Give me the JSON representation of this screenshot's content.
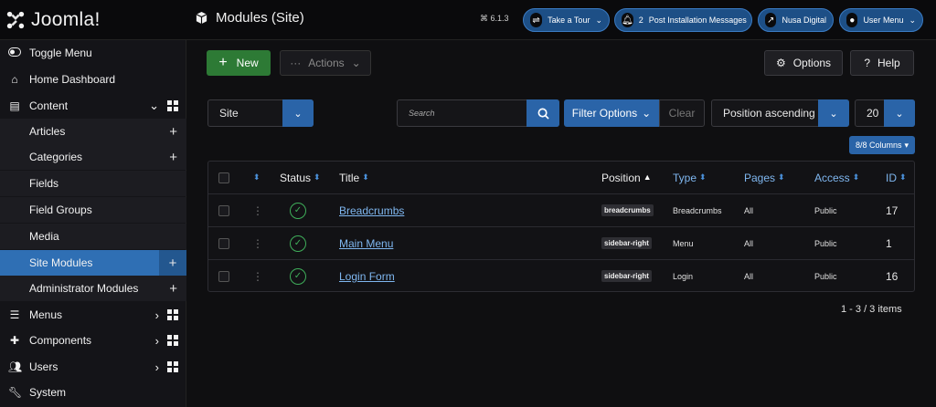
{
  "app": {
    "logo_text": "Joomla!",
    "page_title": "Modules (Site)",
    "version": "⌘ 6.1.3"
  },
  "header_buttons": [
    {
      "label": "Take a Tour",
      "icon": "signpost-icon"
    },
    {
      "label": "Post Installation Messages",
      "count": "2",
      "icon": "bell-icon"
    },
    {
      "label": "Nusa Digital",
      "icon": "external-link-icon"
    },
    {
      "label": "User Menu",
      "icon": "user-icon"
    }
  ],
  "sidebar": {
    "items": [
      {
        "label": "Toggle Menu",
        "icon": "toggle-icon"
      },
      {
        "label": "Home Dashboard",
        "icon": "home-icon"
      },
      {
        "label": "Content",
        "icon": "file-icon"
      },
      {
        "label": "Articles"
      },
      {
        "label": "Categories"
      },
      {
        "label": "Fields"
      },
      {
        "label": "Field Groups"
      },
      {
        "label": "Media"
      },
      {
        "label": "Site Modules"
      },
      {
        "label": "Administrator Modules"
      },
      {
        "label": "Menus",
        "icon": "list-icon"
      },
      {
        "label": "Components",
        "icon": "puzzle-icon"
      },
      {
        "label": "Users",
        "icon": "users-icon"
      },
      {
        "label": "System",
        "icon": "wrench-icon"
      }
    ]
  },
  "toolbar": {
    "new_label": "New",
    "actions_label": "Actions",
    "options_label": "Options",
    "help_label": "Help"
  },
  "filters": {
    "client_value": "Site",
    "search_placeholder": "Search",
    "filter_options_label": "Filter Options",
    "clear_label": "Clear",
    "ordering_value": "Position ascending",
    "limit_value": "20",
    "columns_label": "8/8 Columns"
  },
  "table": {
    "headers": {
      "status": "Status",
      "title": "Title",
      "position": "Position",
      "type": "Type",
      "pages": "Pages",
      "access": "Access",
      "id": "ID"
    },
    "rows": [
      {
        "title": "Breadcrumbs",
        "position": "breadcrumbs",
        "type": "Breadcrumbs",
        "pages": "All",
        "access": "Public",
        "id": "17"
      },
      {
        "title": "Main Menu",
        "position": "sidebar-right",
        "type": "Menu",
        "pages": "All",
        "access": "Public",
        "id": "1"
      },
      {
        "title": "Login Form",
        "position": "sidebar-right",
        "type": "Login",
        "pages": "All",
        "access": "Public",
        "id": "16"
      }
    ]
  },
  "pagination": {
    "summary": "1 - 3 / 3 items"
  },
  "colors": {
    "accent": "#2a64a8",
    "success": "#2d7a35",
    "active": "#2f6fb4"
  }
}
